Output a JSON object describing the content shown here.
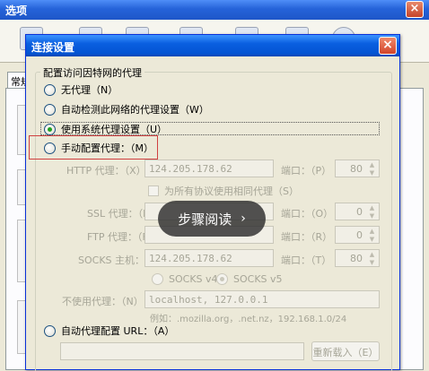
{
  "background_window": {
    "title": "选项",
    "close_glyph": "×",
    "tab_label": "常规"
  },
  "dialog": {
    "title": "连接设置",
    "close_glyph": "×",
    "group_title": "配置访问因特网的代理",
    "options": {
      "no_proxy": "无代理（N）",
      "auto_detect": "自动检测此网络的代理设置（W）",
      "system_proxy": "使用系统代理设置（U）",
      "manual_proxy": "手动配置代理：（M）",
      "auto_config_url": "自动代理配置 URL：（A）"
    },
    "selected_option": "system_proxy",
    "labels": {
      "http_proxy": "HTTP 代理：（X）",
      "ssl_proxy": "SSL 代理：（L）",
      "ftp_proxy": "FTP 代理：（F）",
      "socks_host": "SOCKS 主机：",
      "port_p": "端口：（P）",
      "port_o": "端口：（O）",
      "port_r": "端口：（R）",
      "port_t": "端口：（T）",
      "same_proxy_all": "为所有协议使用相同代理（S）",
      "socks_v4": "SOCKS v4",
      "socks_v5": "SOCKS v5",
      "no_proxy_for": "不使用代理：（N）",
      "example": "例如：.mozilla.org，.net.nz，192.168.1.0/24"
    },
    "values": {
      "http_proxy": "124.205.178.62",
      "http_port": "80",
      "ssl_port": "0",
      "ftp_port": "0",
      "socks_host": "124.205.178.62",
      "socks_port": "80",
      "no_proxy_for": "localhost, 127.0.0.1"
    },
    "reload_button": "重新载入（E）"
  },
  "overlay": {
    "label": "步骤阅读",
    "chevron": "›"
  },
  "colors": {
    "dialog_title_bar": "#0454d3",
    "close_button": "#d2442a",
    "highlight_box": "#d04040",
    "overlay_bg": "#2d2d2d"
  }
}
